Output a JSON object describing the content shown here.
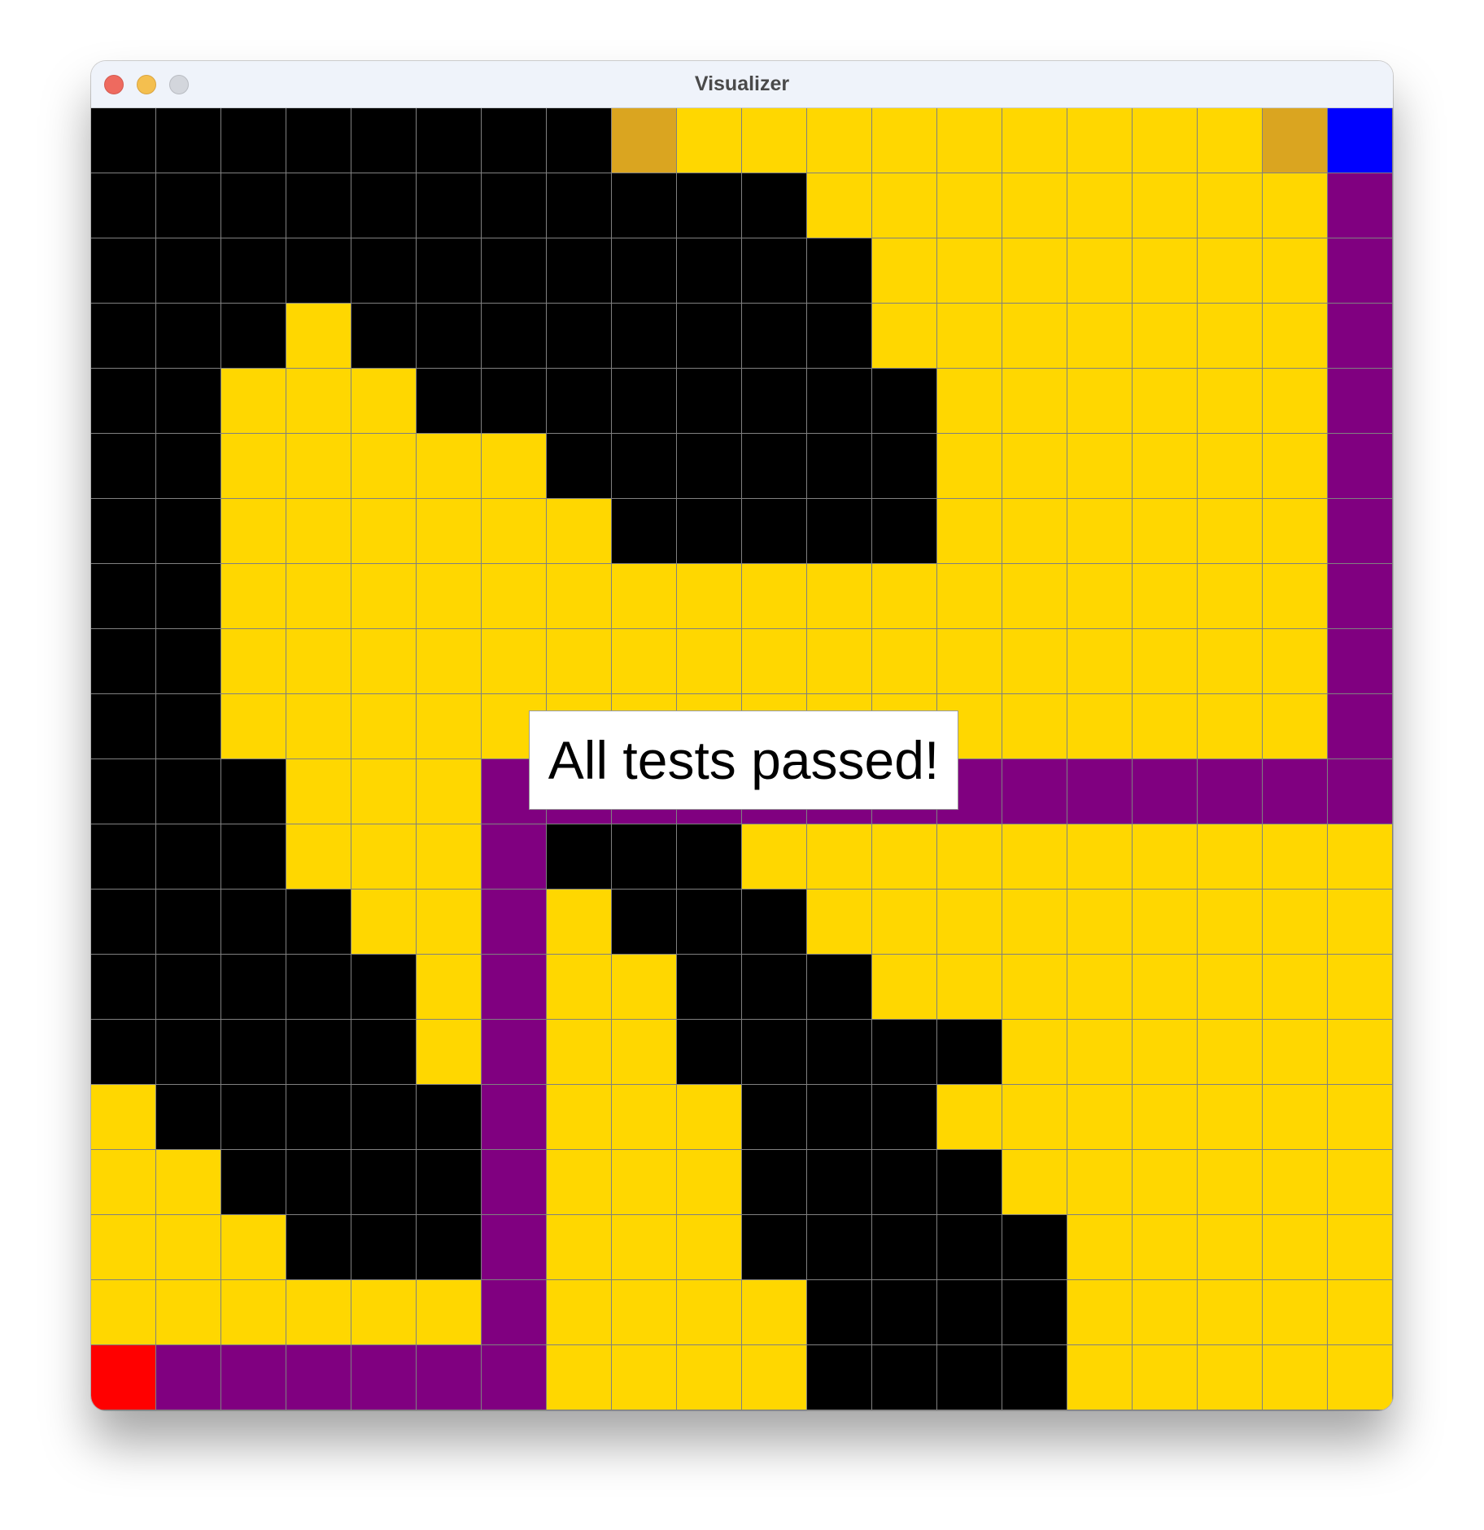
{
  "window": {
    "title": "Visualizer"
  },
  "legend_colors": {
    "W": "#000000",
    "Y": "#FFD700",
    "G": "#DAA520",
    "P": "#800080",
    "B": "#0000FF",
    "R": "#FF0000"
  },
  "grid": {
    "rows": [
      "WWWWWWWWGYYYYYYYYYGB",
      "WWWWWWWWWWWYYYYYYYYP",
      "WWWWWWWWWWWWYYYYYYYP",
      "WWWYWWWWWWWWYYYYYYYP",
      "WWYYYWWWWWWWWYYYYYYP",
      "WWYYYYYWWWWWWYYYYYYP",
      "WWYYYYYYWWWWWYYYYYYP",
      "WWYYYYYYYYYYYYYYYYYP",
      "WWYYYYYYYYYYYYYYYYYP",
      "WWYYYYYYYYYYYYYYYYYP",
      "WWWYYYPPPPPPPPPPPPPP",
      "WWWYYYPWWWYYYYYYYYYY",
      "WWWWYYPYWWWYYYYYYYYY",
      "WWWWWYPYYWWWYYYYYYYY",
      "WWWWWYPYYWWWWWYYYYYY",
      "YWWWWWPYYYWWWYYYYYYY",
      "YYWWWWPYYYWWWWYYYYYY",
      "YYYWWWPYYYWWWWWYYYYY",
      "YYYYYYPYYYYWWWWYYYYY",
      "RPPPPPPYYYYWWWWYYYYY"
    ]
  },
  "status": {
    "message": "All tests passed!"
  }
}
